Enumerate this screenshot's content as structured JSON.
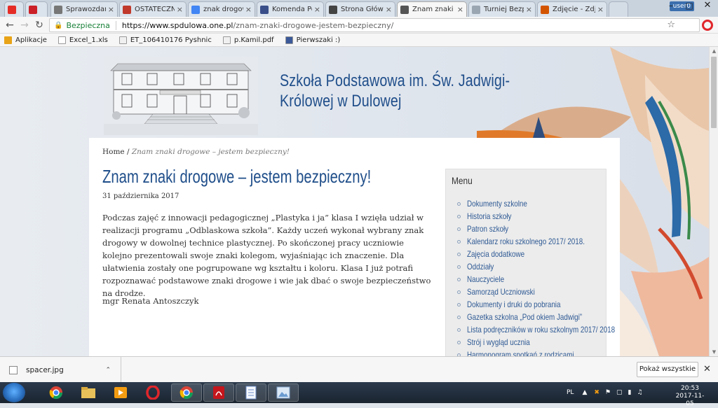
{
  "browser": {
    "tabs": [
      {
        "label": "",
        "icon": "youtube-icon",
        "color": "#e52d27"
      },
      {
        "label": "",
        "icon": "pinterest-icon",
        "color": "#cb2027"
      },
      {
        "label": "Sprawozdanie",
        "icon": "document-icon",
        "color": "#777777"
      },
      {
        "label": "OSTATECZNE",
        "icon": "sheet-icon",
        "color": "#c0392b"
      },
      {
        "label": "znak drogowy",
        "icon": "google-icon",
        "color": "#4285f4"
      },
      {
        "label": "Komenda Po",
        "icon": "police-icon",
        "color": "#3a4f8a"
      },
      {
        "label": "Strona Główn",
        "icon": "page-icon",
        "color": "#444444"
      },
      {
        "label": "Znam znaki d",
        "icon": "pen-icon",
        "color": "#555555",
        "active": true
      },
      {
        "label": "Turniej Bezpie",
        "icon": "page-icon",
        "color": "#9aa6b2"
      },
      {
        "label": "Zdjęcie - Zdję",
        "icon": "photo-icon",
        "color": "#d35400"
      }
    ],
    "user_badge": "user0",
    "secure_label": "Bezpieczna",
    "url_host": "https://www.spdulowa.one.pl",
    "url_path": "/znam-znaki-drogowe-jestem-bezpieczny/",
    "bookmarks": [
      {
        "label": "Aplikacje",
        "icon": "apps-grid-icon"
      },
      {
        "label": "Excel_1.xls",
        "icon": "blank-page-icon"
      },
      {
        "label": "ET_106410176 Pyshnic",
        "icon": "doc-page-icon"
      },
      {
        "label": "p.Kamil.pdf",
        "icon": "doc-page-icon"
      },
      {
        "label": "Pierwszaki :)",
        "icon": "facebook-icon"
      }
    ]
  },
  "site": {
    "title": "Szkoła Podstawowa im. Św. Jadwigi-Królowej w Dulowej",
    "breadcrumb_home": "Home",
    "breadcrumb_sep": " / ",
    "breadcrumb_current": "Znam znaki drogowe – jestem bezpieczny!"
  },
  "post": {
    "title": "Znam znaki drogowe – jestem bezpieczny!",
    "date": "31 października 2017",
    "body": "Podczas zajęć z innowacji pedagogicznej „Plastyka i ja”  klasa I wzięła udział w realizacji programu „Odblaskowa szkoła”. Każdy uczeń wykonał wybrany znak drogowy w dowolnej technice plastycznej. Po skończonej pracy uczniowie kolejno prezentowali swoje znaki kolegom, wyjaśniając ich znaczenie. Dla ułatwienia zostały one pogrupowane wg kształtu i koloru. Klasa I już potrafi rozpoznawać podstawowe znaki drogowe i wie jak dbać o swoje bezpieczeństwo na drodze.",
    "author": "mgr Renata Antoszczyk"
  },
  "sidebar": {
    "title": "Menu",
    "items": [
      "Dokumenty szkolne",
      "Historia szkoły",
      "Patron szkoły",
      "Kalendarz roku szkolnego 2017/ 2018.",
      "Zajęcia dodatkowe",
      "Oddziały",
      "Nauczyciele",
      "Samorząd Uczniowski",
      "Dokumenty i druki do pobrania",
      "Gazetka szkolna „Pod okiem Jadwigi”",
      "Lista podręczników w roku szkolnym 2017/ 2018",
      "Strój i wygląd ucznia",
      "Harmonogram spotkań z rodzicami"
    ]
  },
  "downloads": {
    "file_name": "spacer.jpg",
    "show_all_label": "Pokaż wszystkie"
  },
  "taskbar": {
    "lang": "PL",
    "time": "20:53",
    "date": "2017-11-05"
  }
}
